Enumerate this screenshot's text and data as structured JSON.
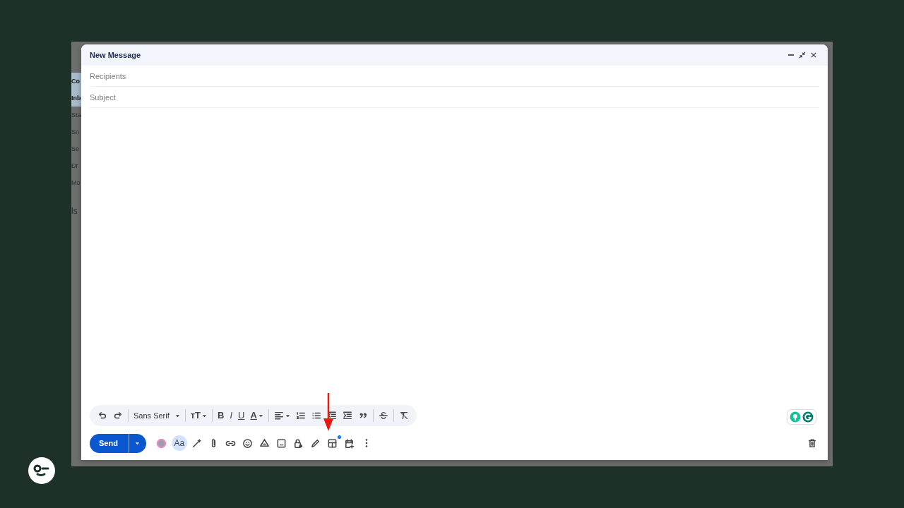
{
  "background_sidebar": {
    "items": [
      {
        "label": "Co",
        "selected": true
      },
      {
        "label": "Inb",
        "selected": true
      },
      {
        "label": "Sta",
        "selected": false
      },
      {
        "label": "Sn",
        "selected": false
      },
      {
        "label": "Se",
        "selected": false
      },
      {
        "label": "Dr",
        "selected": false
      },
      {
        "label": "Mo",
        "selected": false
      },
      {
        "label": "ls",
        "selected": false,
        "kind": "heading"
      }
    ]
  },
  "compose": {
    "title": "New Message",
    "recipients": {
      "placeholder": "Recipients"
    },
    "subject": {
      "placeholder": "Subject"
    },
    "format_bar": [
      {
        "kind": "icon"
      },
      {
        "kind": "icon"
      },
      {
        "kind": "sep"
      },
      {
        "kind": "dropdown",
        "label": "Sans Serif"
      },
      {
        "kind": "sep"
      },
      {
        "kind": "sizedrop",
        "label": "ᴛT"
      },
      {
        "kind": "sep"
      },
      {
        "kind": "bold",
        "label": "B"
      },
      {
        "kind": "italic",
        "label": "I"
      },
      {
        "kind": "underline",
        "label": "U"
      },
      {
        "kind": "colordrop",
        "label": "A"
      },
      {
        "kind": "sep"
      },
      {
        "kind": "icondrop"
      },
      {
        "kind": "icon"
      },
      {
        "kind": "icon"
      },
      {
        "kind": "icon"
      },
      {
        "kind": "icon"
      },
      {
        "kind": "icon"
      },
      {
        "kind": "sep"
      },
      {
        "kind": "icon"
      },
      {
        "kind": "sep"
      },
      {
        "kind": "icon"
      }
    ],
    "send": {
      "label": "Send"
    },
    "actions": [
      {
        "kind": "icon"
      },
      {
        "kind": "text",
        "label": "Aa",
        "selected": true
      },
      {
        "kind": "icon"
      },
      {
        "kind": "icon"
      },
      {
        "kind": "icon"
      },
      {
        "kind": "icon"
      },
      {
        "kind": "icon"
      },
      {
        "kind": "icon"
      },
      {
        "kind": "icon"
      },
      {
        "kind": "icon"
      },
      {
        "kind": "icon",
        "badge": true
      },
      {
        "kind": "icon"
      },
      {
        "kind": "icon"
      }
    ]
  }
}
